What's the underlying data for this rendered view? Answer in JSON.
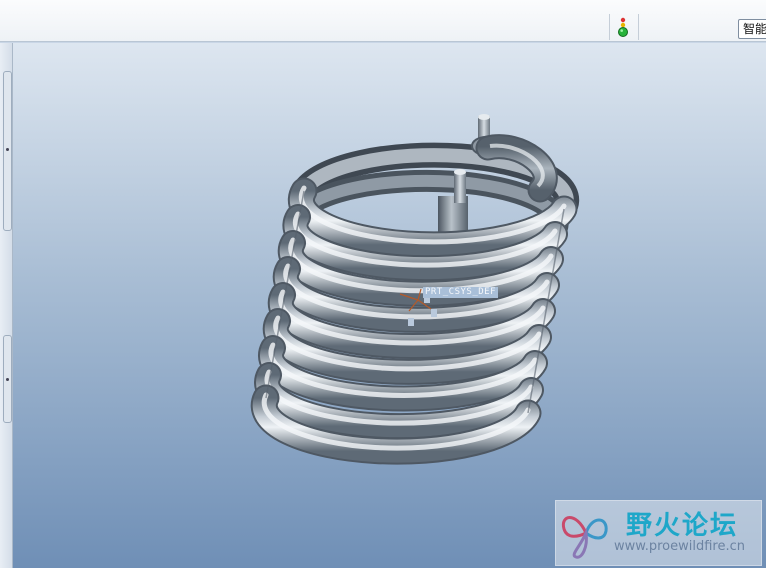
{
  "toolbar": {
    "status_icon": "traffic-light-icon",
    "selection_filter_value": "智能"
  },
  "viewport": {
    "csys_label": "PRT_CSYS_DEF",
    "model": "helical-coil-spring"
  },
  "watermark": {
    "name": "野火论坛",
    "url": "www.proewildfire.cn"
  },
  "colors": {
    "coil": "#c4ccd4",
    "background_top": "#dde6f0",
    "background_bottom": "#6f8fb6",
    "watermark_text": "#1ea7c9"
  }
}
